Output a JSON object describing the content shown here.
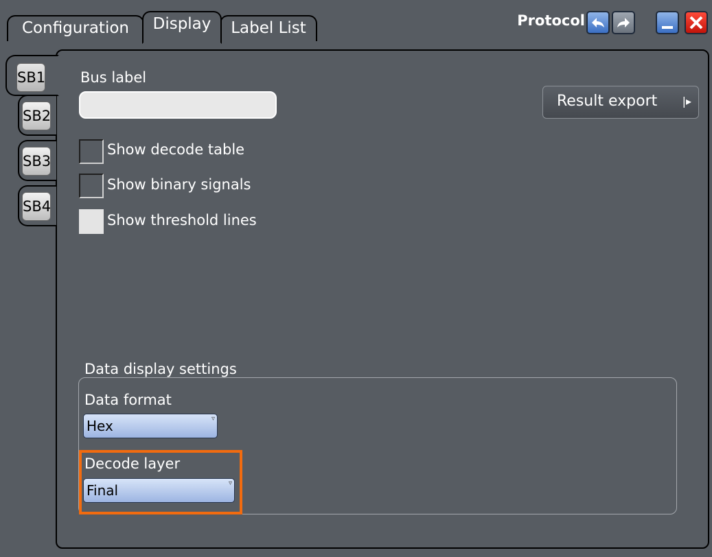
{
  "tabs": [
    {
      "label": "Configuration"
    },
    {
      "label": "Display"
    },
    {
      "label": "Label List"
    }
  ],
  "window": {
    "title": "Protocol",
    "buttons": [
      "undo-icon",
      "redo-icon",
      "minimize-icon",
      "close-icon"
    ]
  },
  "side_tabs": [
    {
      "label": "SB1"
    },
    {
      "label": "SB2"
    },
    {
      "label": "SB3"
    },
    {
      "label": "SB4"
    }
  ],
  "bus_label": {
    "label": "Bus label",
    "value": ""
  },
  "result_export": {
    "label": "Result export",
    "arrow": "|▸"
  },
  "checkboxes": [
    {
      "label": "Show decode table",
      "checked": false
    },
    {
      "label": "Show binary signals",
      "checked": false
    },
    {
      "label": "Show threshold lines",
      "checked": false
    }
  ],
  "data_display": {
    "title": "Data display settings",
    "data_format": {
      "label": "Data format",
      "value": "Hex"
    },
    "decode_layer": {
      "label": "Decode layer",
      "value": "Final"
    }
  },
  "colors": {
    "background": "#575c62",
    "highlight": "#f26b0f",
    "dropdown": "#b9cbef"
  }
}
